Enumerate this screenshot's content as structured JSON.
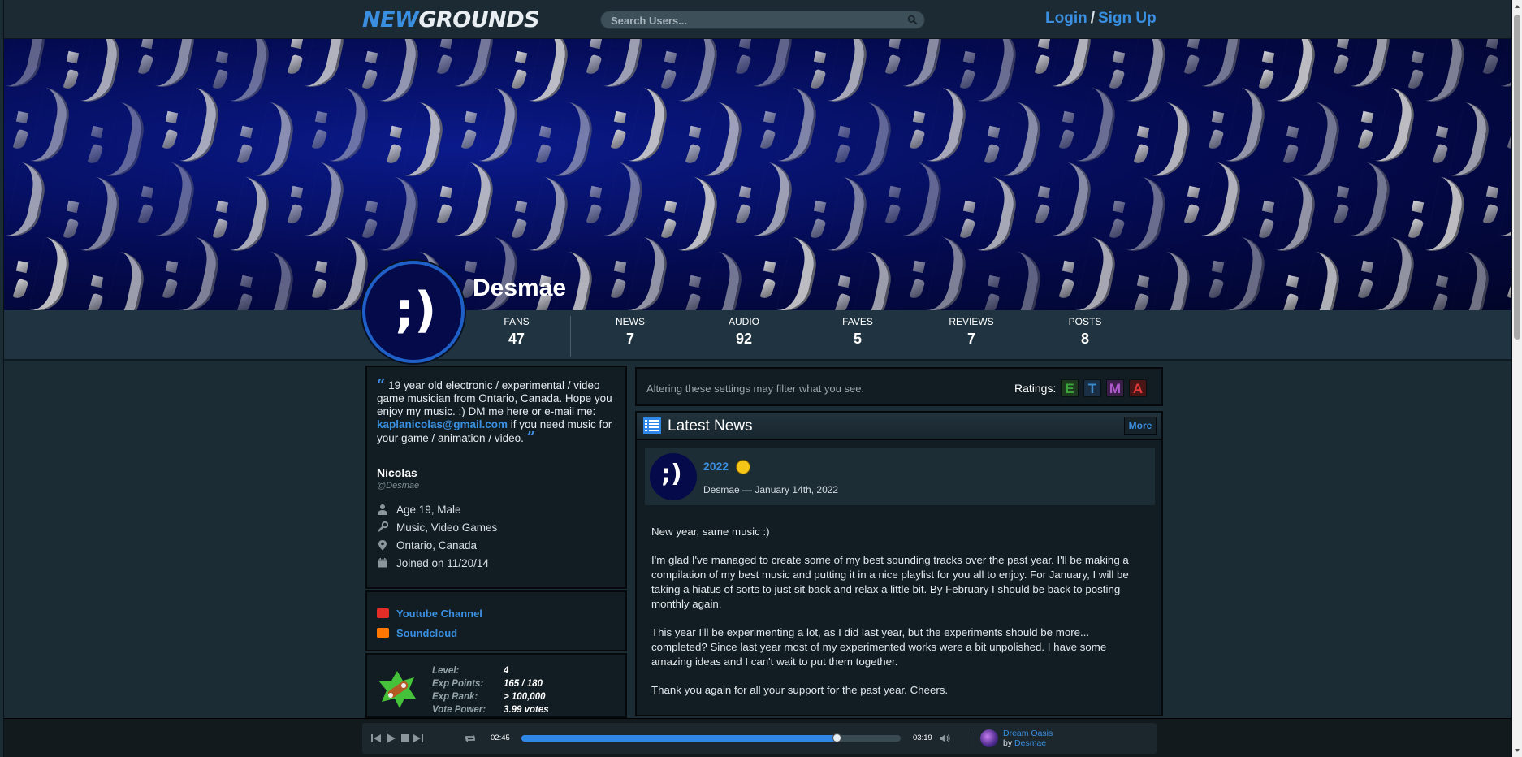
{
  "header": {
    "logo_part1": "NEW",
    "logo_part2": "GROUNDS",
    "search_placeholder": "Search Users...",
    "login": "Login",
    "separator": "/",
    "signup": "Sign Up"
  },
  "profile": {
    "avatar_text": ";)",
    "username": "Desmae",
    "stats": [
      {
        "label": "FANS",
        "value": "47"
      },
      {
        "label": "NEWS",
        "value": "7"
      },
      {
        "label": "AUDIO",
        "value": "92"
      },
      {
        "label": "FAVES",
        "value": "5"
      },
      {
        "label": "REVIEWS",
        "value": "7"
      },
      {
        "label": "POSTS",
        "value": "8"
      }
    ]
  },
  "bio": {
    "open_quote": "“",
    "text_before": "19 year old electronic / experimental / video game musician from Ontario, Canada. Hope you enjoy my music. :) DM me here or e-mail me: ",
    "email": "kaplanicolas@gmail.com",
    "text_after": " if you need music for your game / animation / video.",
    "close_quote": "”",
    "real_name": "Nicolas",
    "handle": "@Desmae",
    "age": "Age 19, Male",
    "interests": "Music, Video Games",
    "location": "Ontario, Canada",
    "joined": "Joined on 11/20/14"
  },
  "links": [
    {
      "label": "Youtube Channel",
      "icon": "youtube-icon",
      "color": "#e52d27"
    },
    {
      "label": "Soundcloud",
      "icon": "soundcloud-icon",
      "color": "#ff7700"
    }
  ],
  "level": {
    "rows": [
      {
        "k": "Level:",
        "v": "4"
      },
      {
        "k": "Exp Points:",
        "v": "165 / 180"
      },
      {
        "k": "Exp Rank:",
        "v": "> 100,000"
      },
      {
        "k": "Vote Power:",
        "v": "3.99 votes"
      }
    ]
  },
  "filter": {
    "message": "Altering these settings may filter what you see.",
    "ratings_label": "Ratings:",
    "ratings": [
      {
        "letter": "E",
        "color": "#3aa53a",
        "bg": "#1e3a1e"
      },
      {
        "letter": "T",
        "color": "#3a8ad0",
        "bg": "#1b2f44"
      },
      {
        "letter": "M",
        "color": "#b05ad0",
        "bg": "#3a1f48"
      },
      {
        "letter": "A",
        "color": "#e03a3a",
        "bg": "#4a1515"
      }
    ]
  },
  "news": {
    "title": "Latest News",
    "more": "More",
    "post_avatar": ";)",
    "post_title": "2022",
    "post_meta": "Desmae — January 14th, 2022",
    "paragraphs": [
      "New year, same music :)",
      "I'm glad I've managed to create some of my best sounding tracks over the past year. I'll be making a compilation of my best music and putting it in a nice playlist for you all to enjoy. For January, I will be taking a hiatus of sorts to just sit back and relax a little bit. By February I should be back to posting monthly again.",
      "This year I'll be experimenting a lot, as I did last year, but the experiments should be more... completed? Since last year most of my experimented works were a bit unpolished. I have some amazing ideas and I can't wait to put them together.",
      "Thank you again for all your support for the past year. Cheers."
    ]
  },
  "player": {
    "elapsed": "02:45",
    "total": "03:19",
    "progress": 0.83,
    "song_title": "Dream Oasis",
    "by_label": "by",
    "artist": "Desmae"
  },
  "colors": {
    "accent": "#3b8fe0",
    "background": "#1b2c35",
    "banner": "#040a4e"
  }
}
